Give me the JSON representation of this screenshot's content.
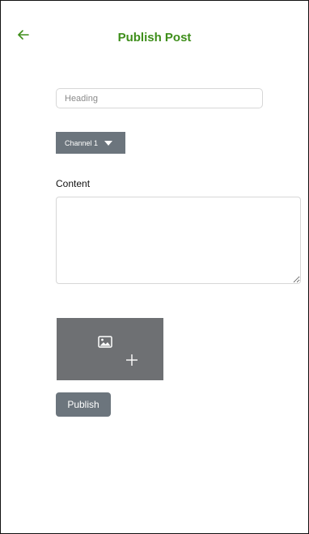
{
  "header": {
    "title": "Publish Post",
    "back_icon": "arrow-left-icon",
    "title_color": "#3e8e1a"
  },
  "form": {
    "heading": {
      "placeholder": "Heading",
      "value": ""
    },
    "channel": {
      "selected": "Channel 1",
      "icon": "caret-down-icon"
    },
    "content": {
      "label": "Content",
      "value": ""
    },
    "image_upload": {
      "icons": [
        "image-icon",
        "plus-icon"
      ]
    },
    "publish_label": "Publish"
  },
  "colors": {
    "button_gray": "#6c757d",
    "upload_gray": "#6e7073",
    "accent_green": "#3e8e1a"
  }
}
